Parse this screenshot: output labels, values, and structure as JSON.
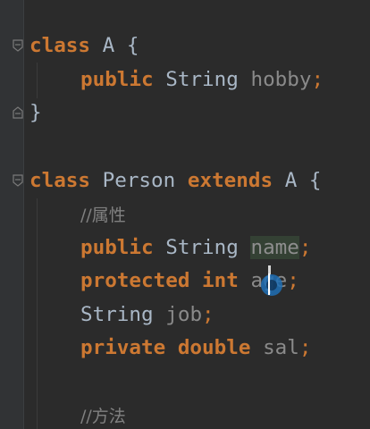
{
  "editor": {
    "lines": [
      {
        "tokens": {
          "kw": "class",
          "name": "A",
          "brace": "{"
        }
      },
      {
        "tokens": {
          "mod": "public",
          "type": "String",
          "field": "hobby",
          "semi": ";"
        }
      },
      {
        "tokens": {
          "brace": "}"
        }
      },
      {
        "tokens": {
          "kw": "class",
          "name": "Person",
          "ext": "extends",
          "parent": "A",
          "brace": "{"
        }
      },
      {
        "tokens": {
          "comment": "//属性"
        }
      },
      {
        "tokens": {
          "mod": "public",
          "type": "String",
          "field": "name",
          "semi": ";"
        }
      },
      {
        "tokens": {
          "mod": "protected",
          "type": "int",
          "field": "age",
          "semi": ";"
        }
      },
      {
        "tokens": {
          "type": "String",
          "field": "job",
          "semi": ";"
        }
      },
      {
        "tokens": {
          "mod": "private",
          "type": "double",
          "field": "sal",
          "semi": ";"
        }
      },
      {
        "tokens": {
          "comment": "//方法"
        }
      }
    ]
  },
  "colors": {
    "background": "#2b2b2b",
    "keyword": "#cc7832",
    "identifier": "#a9b7c6",
    "comment": "#808080",
    "unused_field": "#8a8a8a",
    "highlight": "#344134"
  },
  "icons": [
    "fold-icon",
    "text-cursor-icon"
  ]
}
